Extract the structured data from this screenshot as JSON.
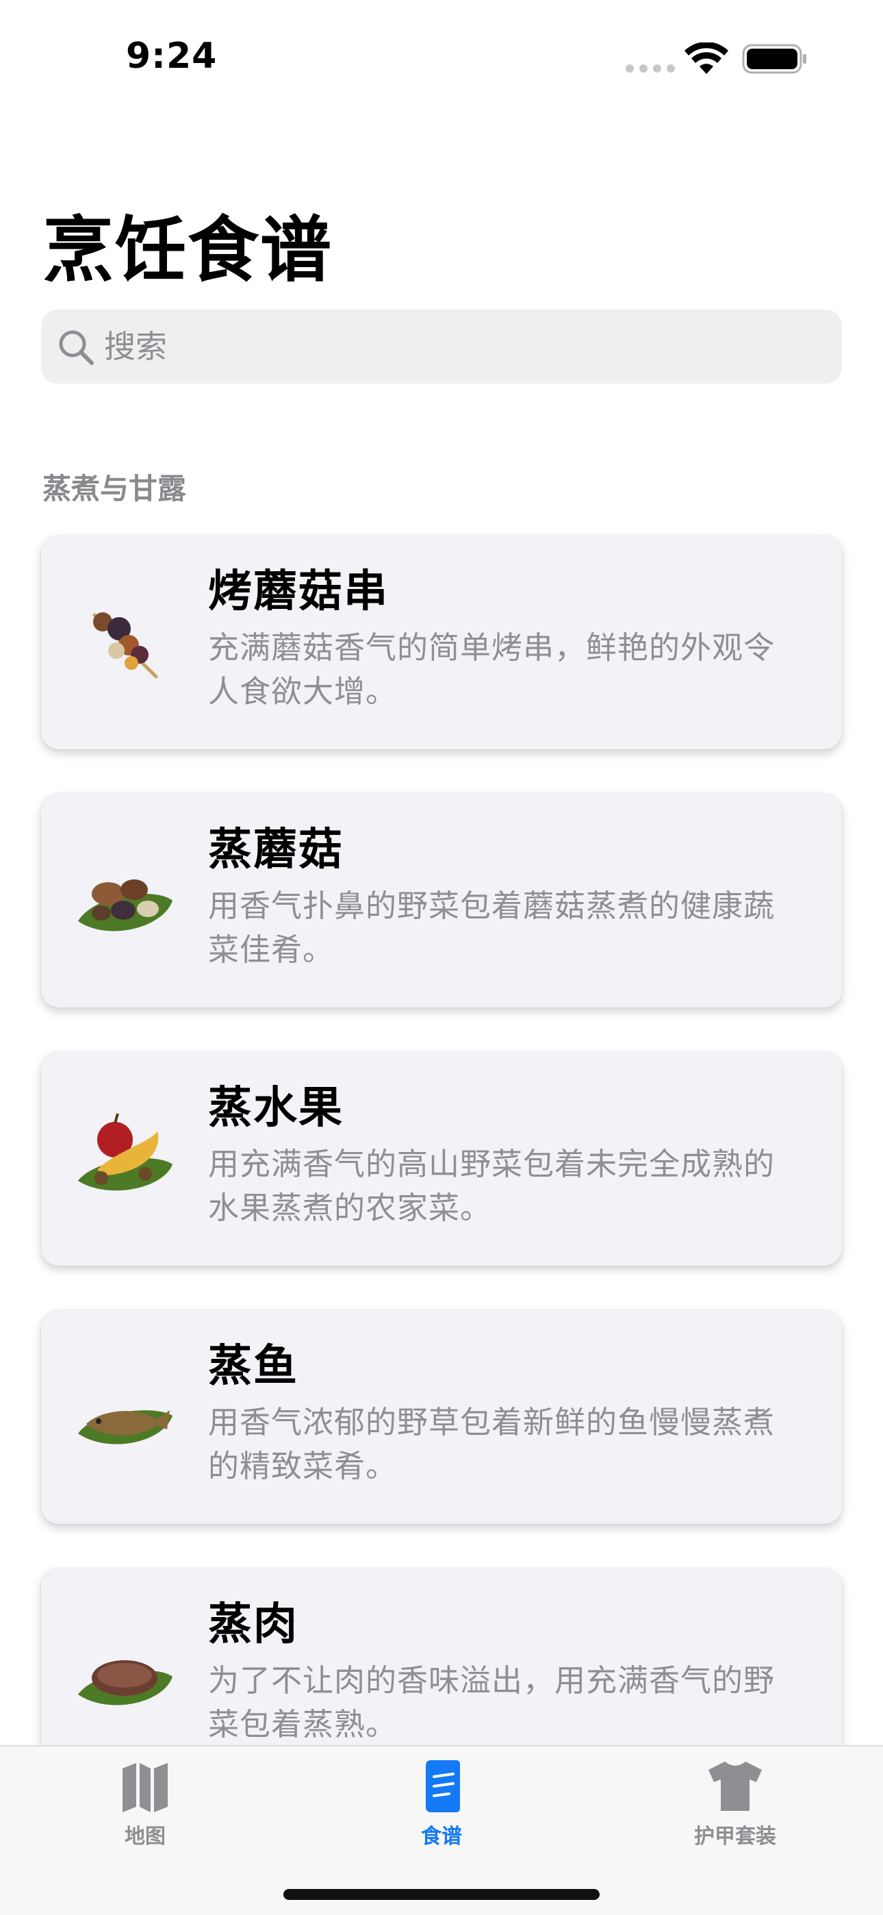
{
  "status_bar": {
    "time": "9:24"
  },
  "page": {
    "title": "烹饪食谱"
  },
  "search": {
    "placeholder": "搜索"
  },
  "section": {
    "header": "蒸煮与甘露"
  },
  "recipes": [
    {
      "name": "烤蘑菇串",
      "description": "充满蘑菇香气的简单烤串，鲜艳的外观令人食欲大增。",
      "icon": "mushroom-skewer-icon"
    },
    {
      "name": "蒸蘑菇",
      "description": "用香气扑鼻的野菜包着蘑菇蒸煮的健康蔬菜佳肴。",
      "icon": "steamed-mushrooms-icon"
    },
    {
      "name": "蒸水果",
      "description": "用充满香气的高山野菜包着未完全成熟的水果蒸煮的农家菜。",
      "icon": "steamed-fruit-icon"
    },
    {
      "name": "蒸鱼",
      "description": "用香气浓郁的野草包着新鲜的鱼慢慢蒸煮的精致菜肴。",
      "icon": "steamed-fish-icon"
    },
    {
      "name": "蒸肉",
      "description": "为了不让肉的香味溢出，用充满香气的野菜包着蒸熟。",
      "icon": "steamed-meat-icon"
    }
  ],
  "tab_bar": {
    "tabs": [
      {
        "label": "地图",
        "icon": "map-icon",
        "active": false
      },
      {
        "label": "食谱",
        "icon": "recipe-book-icon",
        "active": true
      },
      {
        "label": "护甲套装",
        "icon": "shirt-icon",
        "active": false
      }
    ]
  },
  "colors": {
    "accent": "#1479f5",
    "secondary_text": "#8e8e93",
    "card_background": "#f2f2f7"
  }
}
